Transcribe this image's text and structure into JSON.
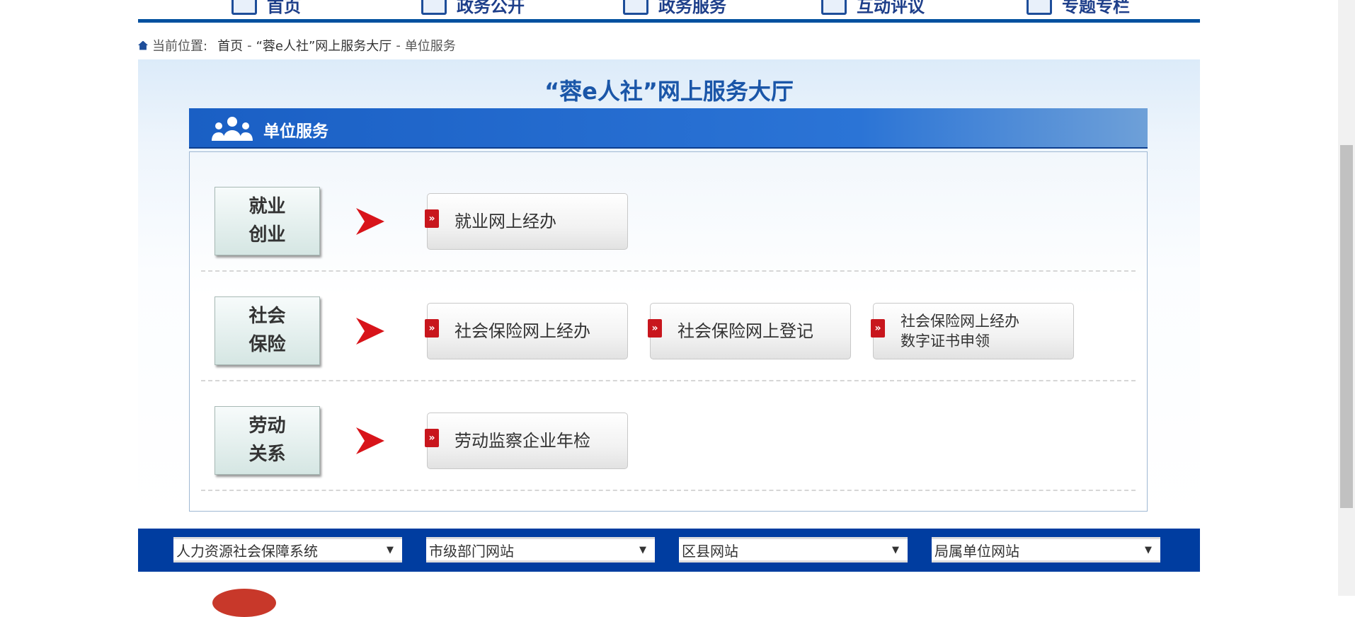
{
  "nav": [
    "首页",
    "政务公开",
    "政务服务",
    "互动评议",
    "专题专栏"
  ],
  "breadcrumb": {
    "label": "当前位置:",
    "home": "首页",
    "sep": "-",
    "hall": "“蓉e人社”网上服务大厅",
    "current": "单位服务"
  },
  "banner_title": "“蓉e人社”网上服务大厅",
  "section_title": "单位服务",
  "categories": [
    {
      "label": [
        "就业",
        "创业"
      ],
      "buttons": [
        "就业网上经办"
      ]
    },
    {
      "label": [
        "社会",
        "保险"
      ],
      "buttons": [
        "社会保险网上经办",
        "社会保险网上登记",
        "社会保险网上经办数字证书申领"
      ],
      "btn3_lines": [
        "社会保险网上经办",
        "数字证书申领"
      ]
    },
    {
      "label": [
        "劳动",
        "关系"
      ],
      "buttons": [
        "劳动监察企业年检"
      ]
    }
  ],
  "mark": "»",
  "footer_selects": [
    "人力资源社会保障系统",
    "市级部门网站",
    "区县网站",
    "局属单位网站"
  ],
  "colors": {
    "nav_blue": "#00509f",
    "footer_blue": "#003da0",
    "arrow_red": "#d8141a"
  }
}
